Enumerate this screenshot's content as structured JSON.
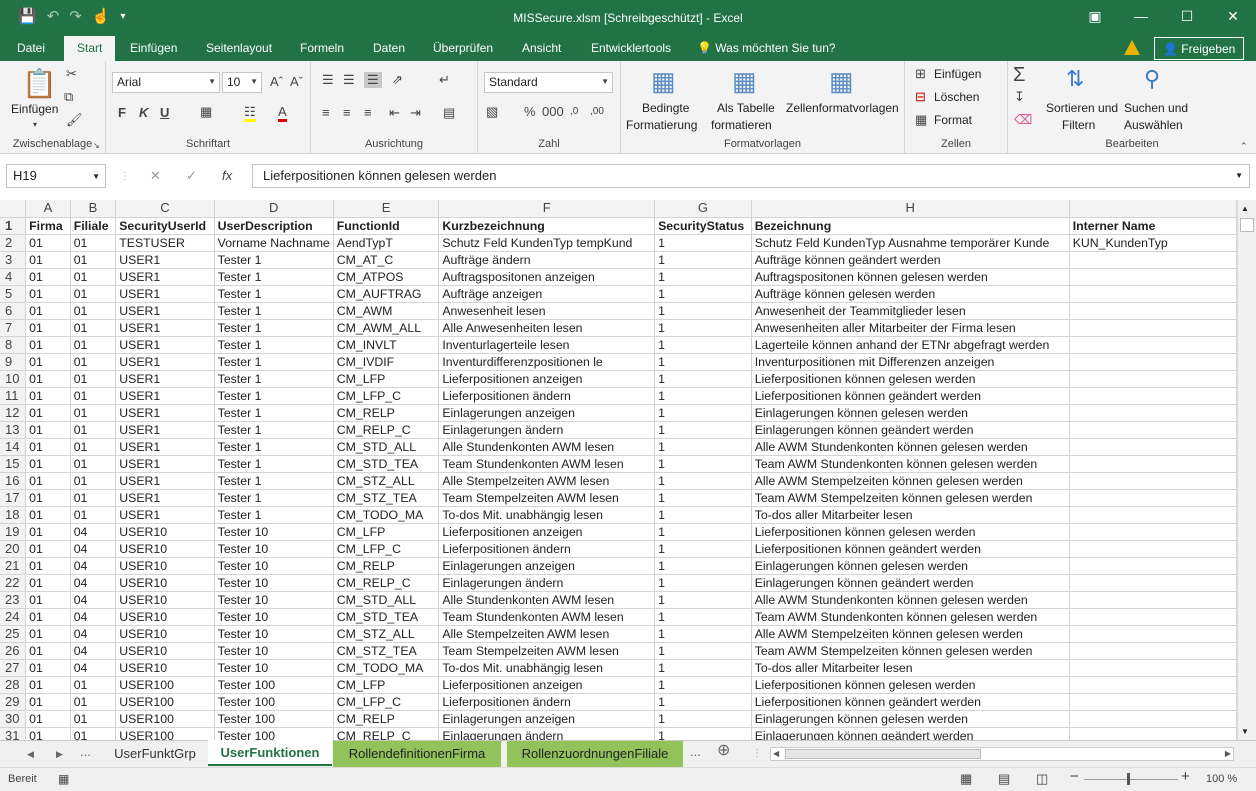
{
  "window": {
    "title": "MISSecure.xlsm  [Schreibgeschützt] - Excel"
  },
  "ribbon_tabs": [
    "Datei",
    "Start",
    "Einfügen",
    "Seitenlayout",
    "Formeln",
    "Daten",
    "Überprüfen",
    "Ansicht",
    "Entwicklertools"
  ],
  "tell_me": "Was möchten Sie tun?",
  "share_label": "Freigeben",
  "ribbon": {
    "clipboard": {
      "paste": "Einfügen",
      "label": "Zwischenablage"
    },
    "font": {
      "name": "Arial",
      "size": "10",
      "bold": "F",
      "italic": "K",
      "underline": "U",
      "label": "Schriftart"
    },
    "alignment": {
      "label": "Ausrichtung"
    },
    "number": {
      "format": "Standard",
      "label": "Zahl"
    },
    "styles": {
      "cond1": "Bedingte",
      "cond2": "Formatierung",
      "table1": "Als Tabelle",
      "table2": "formatieren",
      "cellstyles": "Zellenformatvorlagen",
      "label": "Formatvorlagen"
    },
    "cells": {
      "insert": "Einfügen",
      "delete": "Löschen",
      "format": "Format",
      "label": "Zellen"
    },
    "editing": {
      "sort1": "Sortieren und",
      "sort2": "Filtern",
      "find1": "Suchen und",
      "find2": "Auswählen",
      "label": "Bearbeiten"
    }
  },
  "formula_bar": {
    "name_box": "H19",
    "formula": "Lieferpositionen können gelesen werden"
  },
  "columns": [
    "A",
    "B",
    "C",
    "D",
    "E",
    "F",
    "G",
    "H",
    ""
  ],
  "rows": [
    [
      "Firma",
      "Filiale",
      "SecurityUserId",
      "UserDescription",
      "FunctionId",
      "Kurzbezeichnung",
      "SecurityStatus",
      "Bezeichnung",
      "Interner Name"
    ],
    [
      "01",
      "01",
      "TESTUSER",
      "Vorname Nachname",
      "AendTypT",
      "Schutz Feld KundenTyp tempKund",
      "1",
      "Schutz Feld KundenTyp Ausnahme temporärer Kunde",
      "KUN_KundenTyp"
    ],
    [
      "01",
      "01",
      "USER1",
      "Tester 1",
      "CM_AT_C",
      "Aufträge ändern",
      "1",
      "Aufträge können geändert werden",
      ""
    ],
    [
      "01",
      "01",
      "USER1",
      "Tester 1",
      "CM_ATPOS",
      "Auftragspositonen anzeigen",
      "1",
      "Auftragspositonen können gelesen werden",
      ""
    ],
    [
      "01",
      "01",
      "USER1",
      "Tester 1",
      "CM_AUFTRAG",
      "Aufträge anzeigen",
      "1",
      "Aufträge können gelesen werden",
      ""
    ],
    [
      "01",
      "01",
      "USER1",
      "Tester 1",
      "CM_AWM",
      "Anwesenheit lesen",
      "1",
      "Anwesenheit der Teammitglieder lesen",
      ""
    ],
    [
      "01",
      "01",
      "USER1",
      "Tester 1",
      "CM_AWM_ALL",
      "Alle Anwesenheiten lesen",
      "1",
      "Anwesenheiten aller Mitarbeiter der Firma lesen",
      ""
    ],
    [
      "01",
      "01",
      "USER1",
      "Tester 1",
      "CM_INVLT",
      "Inventurlagerteile lesen",
      "1",
      "Lagerteile können anhand der ETNr abgefragt werden",
      ""
    ],
    [
      "01",
      "01",
      "USER1",
      "Tester 1",
      "CM_IVDIF",
      "Inventurdifferenzpositionen le",
      "1",
      "Inventurpositionen mit Differenzen anzeigen",
      ""
    ],
    [
      "01",
      "01",
      "USER1",
      "Tester 1",
      "CM_LFP",
      "Lieferpositionen anzeigen",
      "1",
      "Lieferpositionen können gelesen werden",
      ""
    ],
    [
      "01",
      "01",
      "USER1",
      "Tester 1",
      "CM_LFP_C",
      "Lieferpositionen ändern",
      "1",
      "Lieferpositionen können geändert werden",
      ""
    ],
    [
      "01",
      "01",
      "USER1",
      "Tester 1",
      "CM_RELP",
      "Einlagerungen anzeigen",
      "1",
      "Einlagerungen können gelesen werden",
      ""
    ],
    [
      "01",
      "01",
      "USER1",
      "Tester 1",
      "CM_RELP_C",
      "Einlagerungen ändern",
      "1",
      "Einlagerungen können geändert werden",
      ""
    ],
    [
      "01",
      "01",
      "USER1",
      "Tester 1",
      "CM_STD_ALL",
      "Alle Stundenkonten AWM lesen",
      "1",
      "Alle AWM Stundenkonten können gelesen werden",
      ""
    ],
    [
      "01",
      "01",
      "USER1",
      "Tester 1",
      "CM_STD_TEA",
      "Team Stundenkonten AWM lesen",
      "1",
      "Team AWM Stundenkonten können gelesen werden",
      ""
    ],
    [
      "01",
      "01",
      "USER1",
      "Tester 1",
      "CM_STZ_ALL",
      "Alle Stempelzeiten AWM lesen",
      "1",
      "Alle AWM Stempelzeiten können gelesen werden",
      ""
    ],
    [
      "01",
      "01",
      "USER1",
      "Tester 1",
      "CM_STZ_TEA",
      "Team Stempelzeiten AWM lesen",
      "1",
      "Team AWM Stempelzeiten können gelesen werden",
      ""
    ],
    [
      "01",
      "01",
      "USER1",
      "Tester 1",
      "CM_TODO_MA",
      "To-dos Mit. unabhängig lesen",
      "1",
      "To-dos aller Mitarbeiter lesen",
      ""
    ],
    [
      "01",
      "04",
      "USER10",
      "Tester 10",
      "CM_LFP",
      "Lieferpositionen anzeigen",
      "1",
      "Lieferpositionen können gelesen werden",
      ""
    ],
    [
      "01",
      "04",
      "USER10",
      "Tester 10",
      "CM_LFP_C",
      "Lieferpositionen ändern",
      "1",
      "Lieferpositionen können geändert werden",
      ""
    ],
    [
      "01",
      "04",
      "USER10",
      "Tester 10",
      "CM_RELP",
      "Einlagerungen anzeigen",
      "1",
      "Einlagerungen können gelesen werden",
      ""
    ],
    [
      "01",
      "04",
      "USER10",
      "Tester 10",
      "CM_RELP_C",
      "Einlagerungen ändern",
      "1",
      "Einlagerungen können geändert werden",
      ""
    ],
    [
      "01",
      "04",
      "USER10",
      "Tester 10",
      "CM_STD_ALL",
      "Alle Stundenkonten AWM lesen",
      "1",
      "Alle AWM Stundenkonten können gelesen werden",
      ""
    ],
    [
      "01",
      "04",
      "USER10",
      "Tester 10",
      "CM_STD_TEA",
      "Team Stundenkonten AWM lesen",
      "1",
      "Team AWM Stundenkonten können gelesen werden",
      ""
    ],
    [
      "01",
      "04",
      "USER10",
      "Tester 10",
      "CM_STZ_ALL",
      "Alle Stempelzeiten AWM lesen",
      "1",
      "Alle AWM Stempelzeiten können gelesen werden",
      ""
    ],
    [
      "01",
      "04",
      "USER10",
      "Tester 10",
      "CM_STZ_TEA",
      "Team Stempelzeiten AWM lesen",
      "1",
      "Team AWM Stempelzeiten können gelesen werden",
      ""
    ],
    [
      "01",
      "04",
      "USER10",
      "Tester 10",
      "CM_TODO_MA",
      "To-dos Mit. unabhängig lesen",
      "1",
      "To-dos aller Mitarbeiter lesen",
      ""
    ],
    [
      "01",
      "01",
      "USER100",
      "Tester 100",
      "CM_LFP",
      "Lieferpositionen anzeigen",
      "1",
      "Lieferpositionen können gelesen werden",
      ""
    ],
    [
      "01",
      "01",
      "USER100",
      "Tester 100",
      "CM_LFP_C",
      "Lieferpositionen ändern",
      "1",
      "Lieferpositionen können geändert werden",
      ""
    ],
    [
      "01",
      "01",
      "USER100",
      "Tester 100",
      "CM_RELP",
      "Einlagerungen anzeigen",
      "1",
      "Einlagerungen können gelesen werden",
      ""
    ],
    [
      "01",
      "01",
      "USER100",
      "Tester 100",
      "CM_RELP_C",
      "Einlagerungen ändern",
      "1",
      "Einlagerungen können geändert werden",
      ""
    ]
  ],
  "sheets": [
    "UserFunktGrp",
    "UserFunktionen",
    "RollendefinitionenFirma",
    "RollenzuordnungenFiliale"
  ],
  "active_sheet": "UserFunktionen",
  "status": {
    "ready": "Bereit",
    "zoom": "100 %"
  }
}
